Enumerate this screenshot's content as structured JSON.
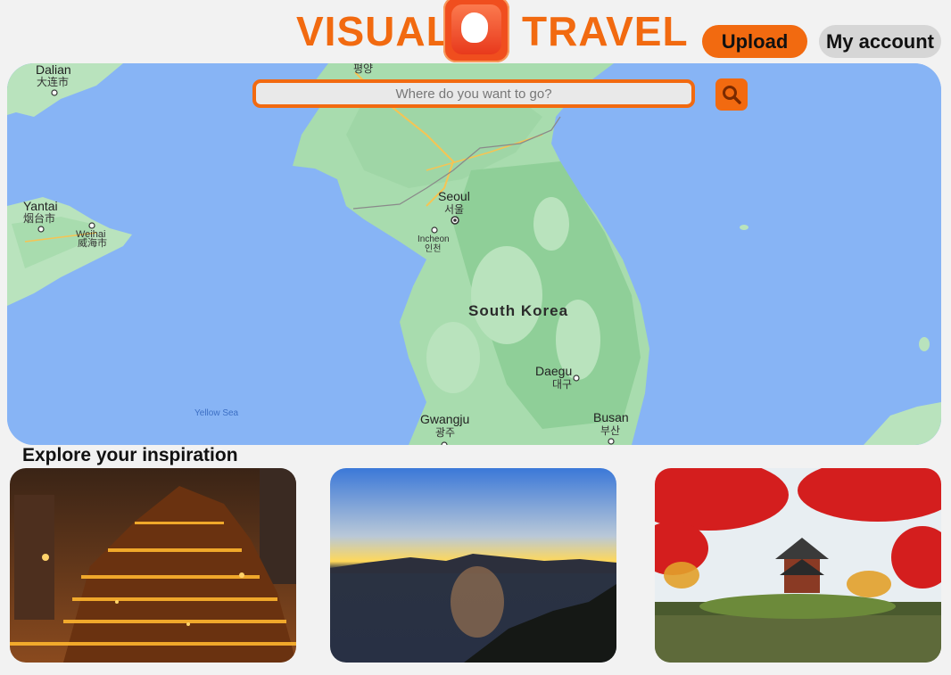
{
  "header": {
    "logo_left": "VISUAL",
    "logo_right": "TRAVEL",
    "upload_label": "Upload",
    "account_label": "My account"
  },
  "search": {
    "placeholder": "Where do you want to go?"
  },
  "map": {
    "labels": {
      "dalian": "Dalian",
      "dalian_cn": "大连市",
      "pyongyang_kr": "평양",
      "yantai": "Yantai",
      "yantai_cn": "烟台市",
      "weihai": "Weihai",
      "weihai_cn": "威海市",
      "seoul": "Seoul",
      "seoul_kr": "서울",
      "incheon": "Incheon",
      "incheon_kr": "인천",
      "south_korea": "South Korea",
      "daegu": "Daegu",
      "daegu_kr": "대구",
      "gwangju": "Gwangju",
      "gwangju_kr": "광주",
      "busan": "Busan",
      "busan_kr": "부산",
      "yellow_sea": "Yellow Sea"
    }
  },
  "explore": {
    "title": "Explore your inspiration"
  },
  "colors": {
    "accent": "#f26a10",
    "sea": "#87b4f5",
    "land": "#9fd6a6"
  }
}
